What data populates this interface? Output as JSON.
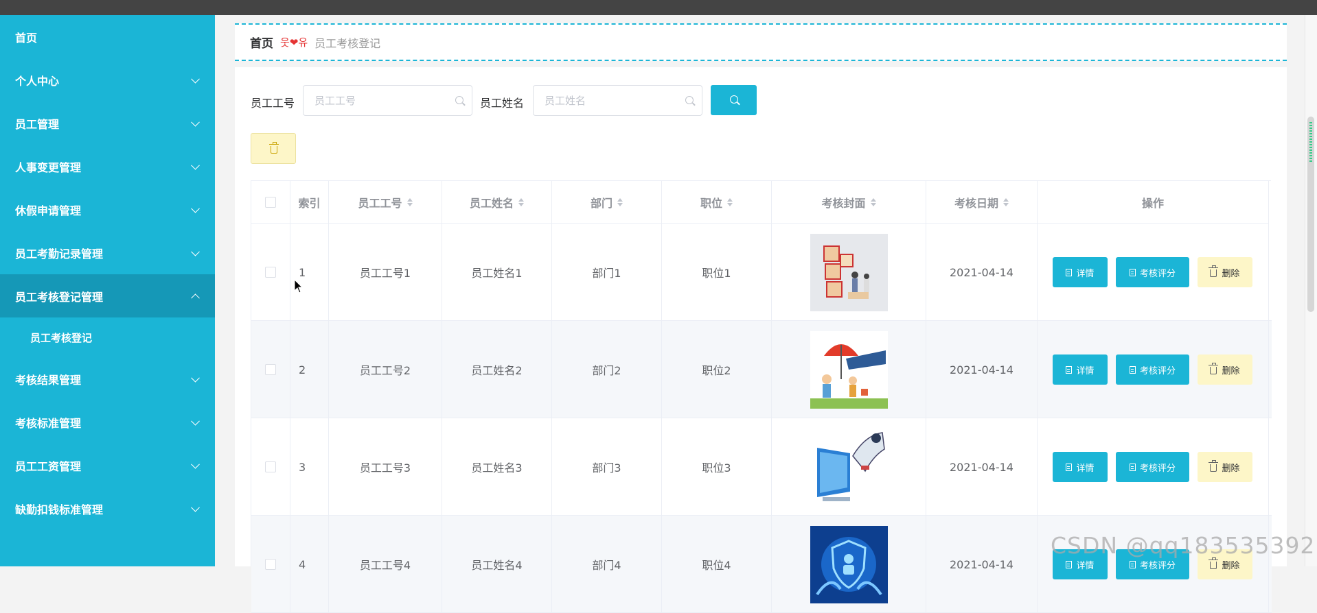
{
  "sidebar": {
    "items": [
      {
        "label": "首页",
        "expandable": false
      },
      {
        "label": "个人中心",
        "expandable": true
      },
      {
        "label": "员工管理",
        "expandable": true
      },
      {
        "label": "人事变更管理",
        "expandable": true
      },
      {
        "label": "休假申请管理",
        "expandable": true
      },
      {
        "label": "员工考勤记录管理",
        "expandable": true
      },
      {
        "label": "员工考核登记管理",
        "expandable": true,
        "active": true,
        "expanded": true
      },
      {
        "label": "考核结果管理",
        "expandable": true
      },
      {
        "label": "考核标准管理",
        "expandable": true
      },
      {
        "label": "员工工资管理",
        "expandable": true
      },
      {
        "label": "缺勤扣钱标准管理",
        "expandable": true
      }
    ],
    "subitem": "员工考核登记",
    "bg_color": "#1bb5d6",
    "active_color": "#1598b7"
  },
  "breadcrumb": {
    "home": "首页",
    "separator": "웃❤유",
    "current": "员工考核登记"
  },
  "search": {
    "emp_no_label": "员工工号",
    "emp_no_placeholder": "员工工号",
    "emp_name_label": "员工姓名",
    "emp_name_placeholder": "员工姓名",
    "button_icon": "search-icon",
    "delete_icon": "trash-icon"
  },
  "table": {
    "headers": [
      "索引",
      "员工工号",
      "员工姓名",
      "部门",
      "职位",
      "考核封面",
      "考核日期",
      "操作"
    ],
    "rows": [
      {
        "index": "1",
        "emp_no": "员工工号1",
        "emp_name": "员工姓名1",
        "dept": "部门1",
        "position": "职位1",
        "cover": "insurance-blocks-image",
        "date": "2021-04-14"
      },
      {
        "index": "2",
        "emp_no": "员工工号2",
        "emp_name": "员工姓名2",
        "dept": "部门2",
        "position": "职位2",
        "cover": "umbrella-family-image",
        "date": "2021-04-14"
      },
      {
        "index": "3",
        "emp_no": "员工工号3",
        "emp_name": "员工姓名3",
        "dept": "部门3",
        "position": "职位3",
        "cover": "computer-user-image",
        "date": "2021-04-14"
      },
      {
        "index": "4",
        "emp_no": "员工工号4",
        "emp_name": "员工姓名4",
        "dept": "部门4",
        "position": "职位4",
        "cover": "shield-hands-image",
        "date": "2021-04-14"
      }
    ],
    "actions": {
      "detail": "详情",
      "score": "考核评分",
      "delete": "删除"
    }
  },
  "watermark": "CSDN @qq183535392",
  "colors": {
    "primary": "#1bb5d6",
    "warning_bg": "#fdf6c8",
    "breadcrumb_sep": "#e53333"
  }
}
